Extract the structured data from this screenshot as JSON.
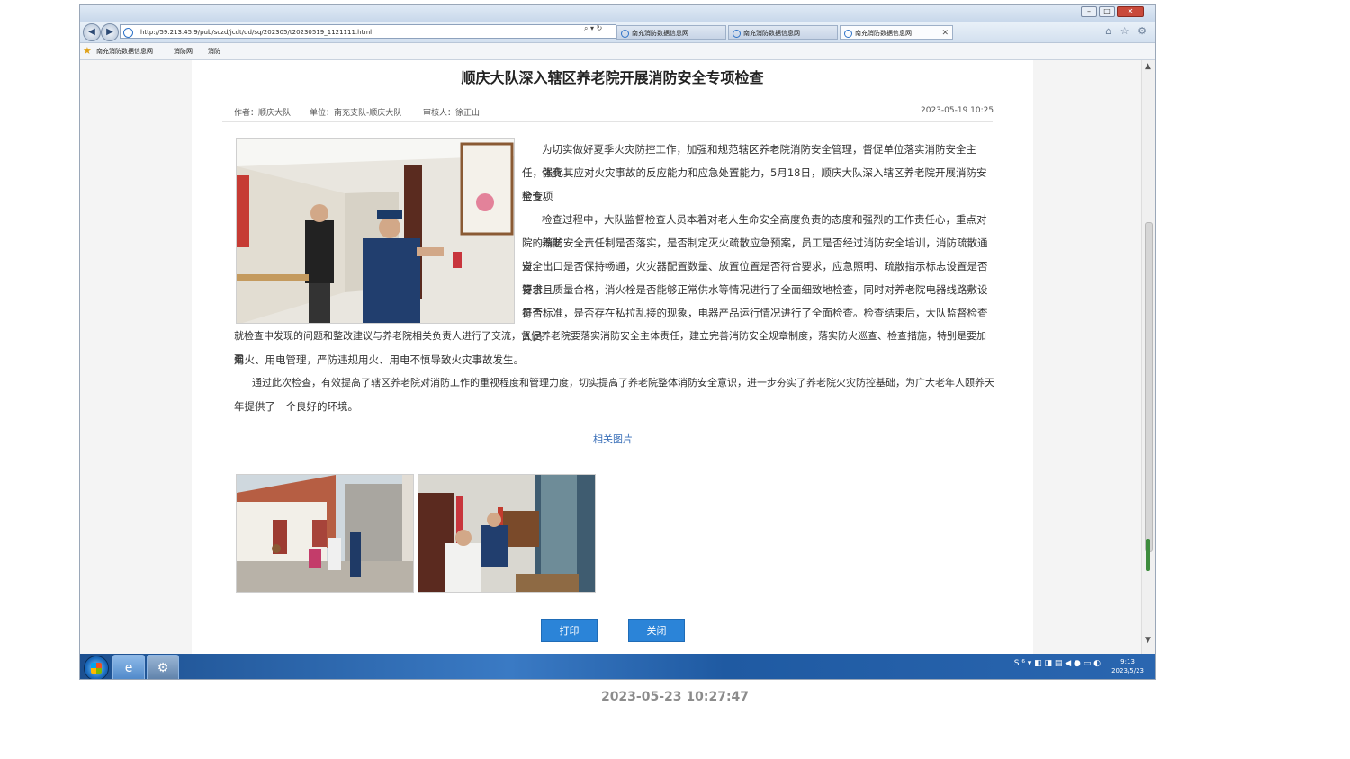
{
  "browser": {
    "address": "http://59.213.45.9/pub/sczd/jcdt/dd/sq/202305/t20230519_1121111.html",
    "address_tools": "⌕ ▾ ↻",
    "tabs": [
      {
        "label": "南充消防数据信息网"
      },
      {
        "label": "南充消防数据信息网"
      },
      {
        "label": "南充消防数据信息网"
      }
    ],
    "tab_close": "✕",
    "favorites": [
      "南充消防数据信息网",
      "消防网",
      "消防"
    ],
    "right_icons": "⌂ ☆ ⚙"
  },
  "article": {
    "title": "顺庆大队深入辖区养老院开展消防安全专项检查",
    "author": "作者：顺庆大队",
    "unit": "单位：南充支队-顺庆大队",
    "reviewer": "审核人：徐正山",
    "datetime": "2023-05-19 10:25",
    "p1_a": "为切实做好夏季火灾防控工作，加强和规范辖区养老院消防安全管理，督促单位落实消防安全主体责",
    "p1_b": "任，强化其应对火灾事故的反应能力和应急处置能力，5月18日，顺庆大队深入辖区养老院开展消防安全专项",
    "p1_c": "检查。",
    "p2_a": "检查过程中，大队监督检查人员本着对老人生命安全高度负责的态度和强烈的工作责任心，重点对养老",
    "p2_b": "院的消防安全责任制是否落实，是否制定灭火疏散应急预案，员工是否经过消防安全培训，消防疏散通道、",
    "p2_c": "安全出口是否保持畅通，火灾器配置数量、放置位置是否符合要求，应急照明、疏散指示标志设置是否符合",
    "p2_d": "要求且质量合格，消火栓是否能够正常供水等情况进行了全面细致地检查，同时对养老院电器线路敷设是否",
    "p2_e": "符合标准，是否存在私拉乱接的现象，电器产品运行情况进行了全面检查。检查结束后，大队监督检查人员",
    "p2_f": "就检查中发现的问题和整改建议与养老院相关负责人进行了交流，督促养老院要落实消防安全主体责任，建立完善消防安全规章制度，落实防火巡查、检查措施，特别是要加强",
    "p2_g": "用火、用电管理，严防违规用火、用电不慎导致火灾事故发生。",
    "p3_a": "通过此次检查，有效提高了辖区养老院对消防工作的重视程度和管理力度，切实提高了养老院整体消防安全意识，进一步夯实了养老院火灾防控基础，为广大老年人颐养天",
    "p3_b": "年提供了一个良好的环境。",
    "related_label": "相关图片",
    "print_label": "打印",
    "close_label": "关闭"
  },
  "taskbar": {
    "tray": "S ⁶ ▾ ◧ ◨ ▤ ◀ ● ▭ ◐",
    "time": "9:13",
    "date": "2023/5/23"
  },
  "screenshot_timestamp": "2023-05-23 10:27:47"
}
